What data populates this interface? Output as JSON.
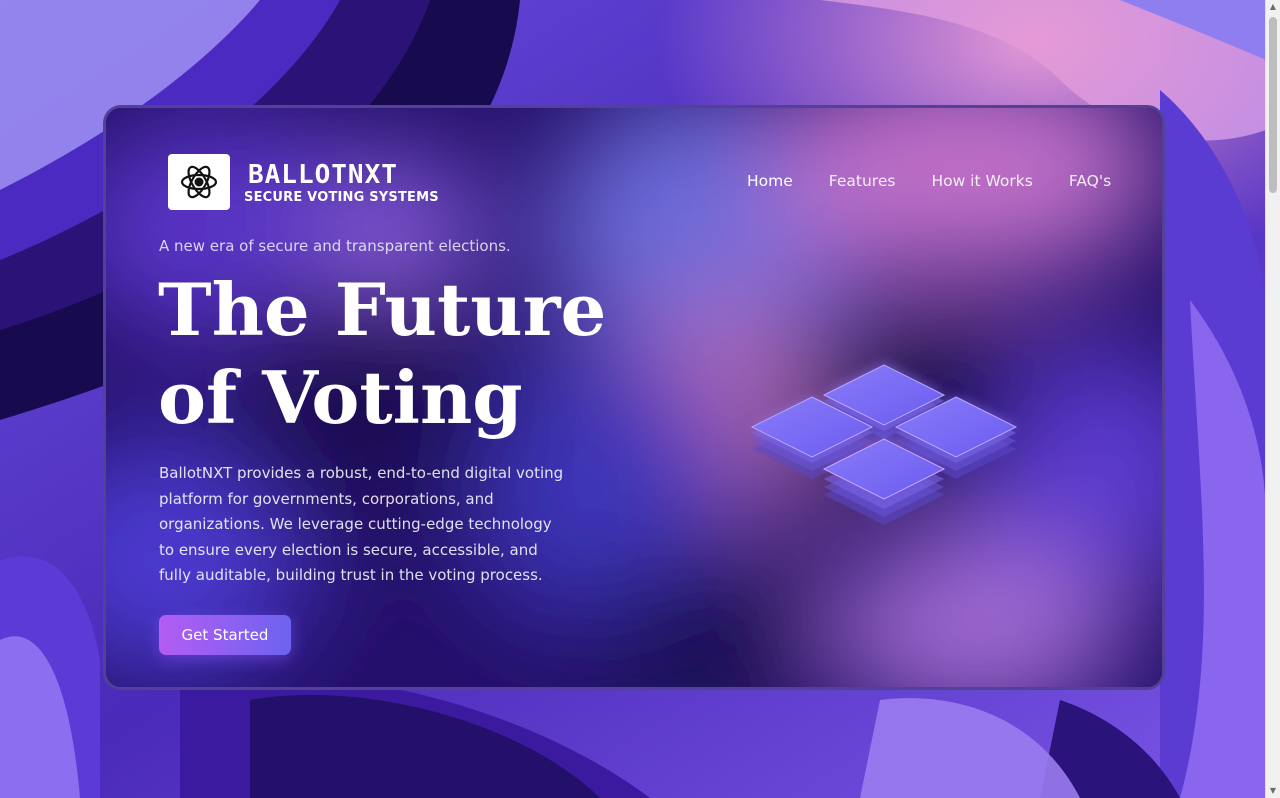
{
  "brand": {
    "name": "BALLOTNXT",
    "tagline": "SECURE VOTING SYSTEMS",
    "logo_icon": "atom-icon"
  },
  "nav": {
    "items": [
      {
        "label": "Home",
        "active": true
      },
      {
        "label": "Features",
        "active": false
      },
      {
        "label": "How it Works",
        "active": false
      },
      {
        "label": "FAQ's",
        "active": false
      }
    ]
  },
  "hero": {
    "subtitle": "A new era of secure and transparent elections.",
    "title_line1": "The Future",
    "title_line2": "of Voting",
    "description": "BallotNXT provides a robust, end-to-end digital voting platform for governments, corporations, and organizations. We leverage cutting-edge technology to ensure every election is secure, accessible, and fully auditable, building trust in the voting process.",
    "cta_label": "Get Started",
    "illustration": "isometric-tiles-icon"
  },
  "colors": {
    "accent_start": "#b45cf4",
    "accent_end": "#6d63f0",
    "background": "#3a1f8f"
  }
}
